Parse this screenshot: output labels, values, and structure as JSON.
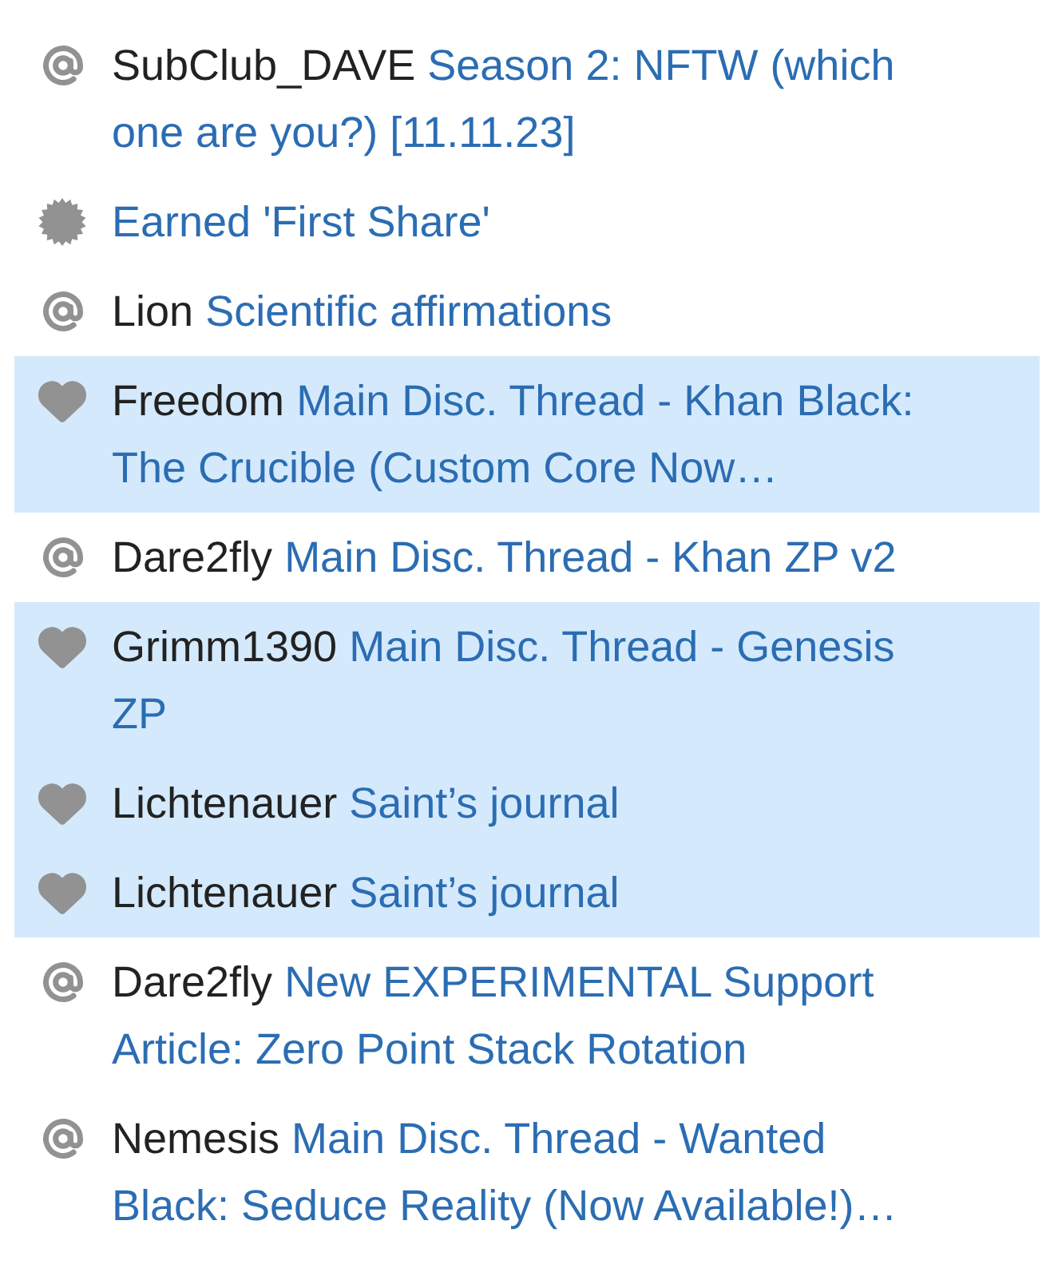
{
  "notifications": [
    {
      "kind": "mention",
      "username": "SubClub_DAVE",
      "title": "Season 2: NFTW (which one are you?) [11.11.23]",
      "unread": false
    },
    {
      "kind": "badge",
      "title": "Earned 'First Share'",
      "unread": false
    },
    {
      "kind": "mention",
      "username": "Lion",
      "title": "Scientific affirmations",
      "unread": false
    },
    {
      "kind": "like",
      "username": "Freedom",
      "title": "Main Disc. Thread - Khan Black: The Crucible (Custom Core Now…",
      "unread": true
    },
    {
      "kind": "mention",
      "username": "Dare2fly",
      "title": "Main Disc. Thread - Khan ZP v2",
      "unread": false
    },
    {
      "kind": "like",
      "username": "Grimm1390",
      "title": "Main Disc. Thread - Genesis ZP",
      "unread": true
    },
    {
      "kind": "like",
      "username": "Lichtenauer",
      "title": "Saint’s journal",
      "unread": true
    },
    {
      "kind": "like",
      "username": "Lichtenauer",
      "title": "Saint’s journal",
      "unread": true
    },
    {
      "kind": "mention",
      "username": "Dare2fly",
      "title": "New EXPERIMENTAL Support Article: Zero Point Stack Rotation",
      "unread": false
    },
    {
      "kind": "mention",
      "username": "Nemesis",
      "title": "Main Disc. Thread - Wanted Black: Seduce Reality (Now Available!)…",
      "unread": false
    }
  ]
}
